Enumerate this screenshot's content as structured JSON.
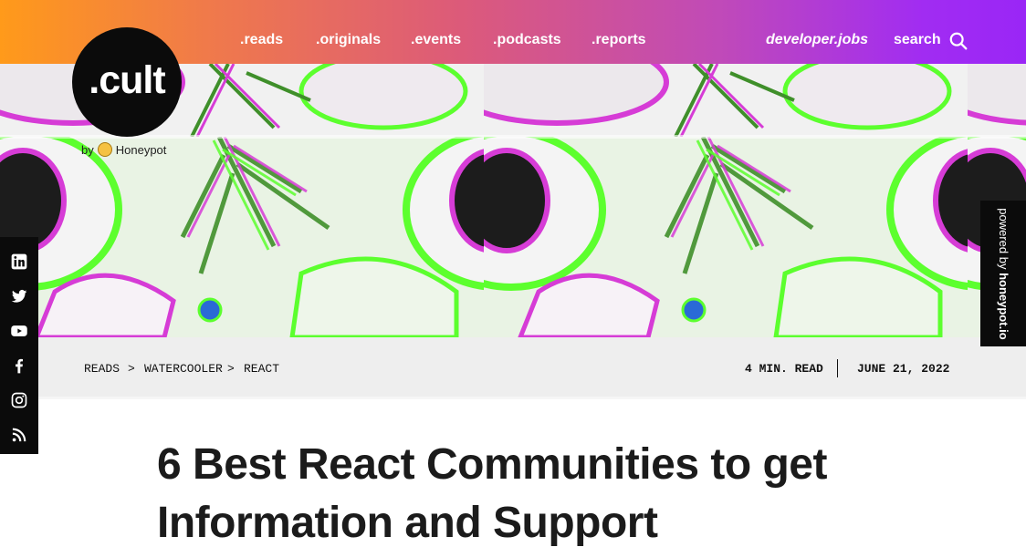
{
  "brand": {
    "logo_text": ".cult",
    "byline_prefix": "by",
    "byline_name": "Honeypot"
  },
  "nav": {
    "items": [
      ".reads",
      ".originals",
      ".events",
      ".podcasts",
      ".reports"
    ],
    "jobs_label": "developer.jobs",
    "search_label": "search"
  },
  "powered": {
    "prefix": "powered by ",
    "name": "honeypot.io"
  },
  "social": [
    "linkedin-icon",
    "twitter-icon",
    "youtube-icon",
    "facebook-icon",
    "instagram-icon",
    "rss-icon"
  ],
  "breadcrumb": {
    "items": [
      "READS",
      "WATERCOOLER",
      "REACT"
    ],
    "separator": ">"
  },
  "article": {
    "read_time": "4 MIN. READ",
    "date": "JUNE 21, 2022",
    "title": "6 Best React Communities to get Information and Support"
  },
  "colors": {
    "gradient_start": "#ff9a1a",
    "gradient_end": "#9a26f6",
    "accent_green": "#5cff2e",
    "accent_magenta": "#d63cd6",
    "dark": "#0b0b0b"
  }
}
